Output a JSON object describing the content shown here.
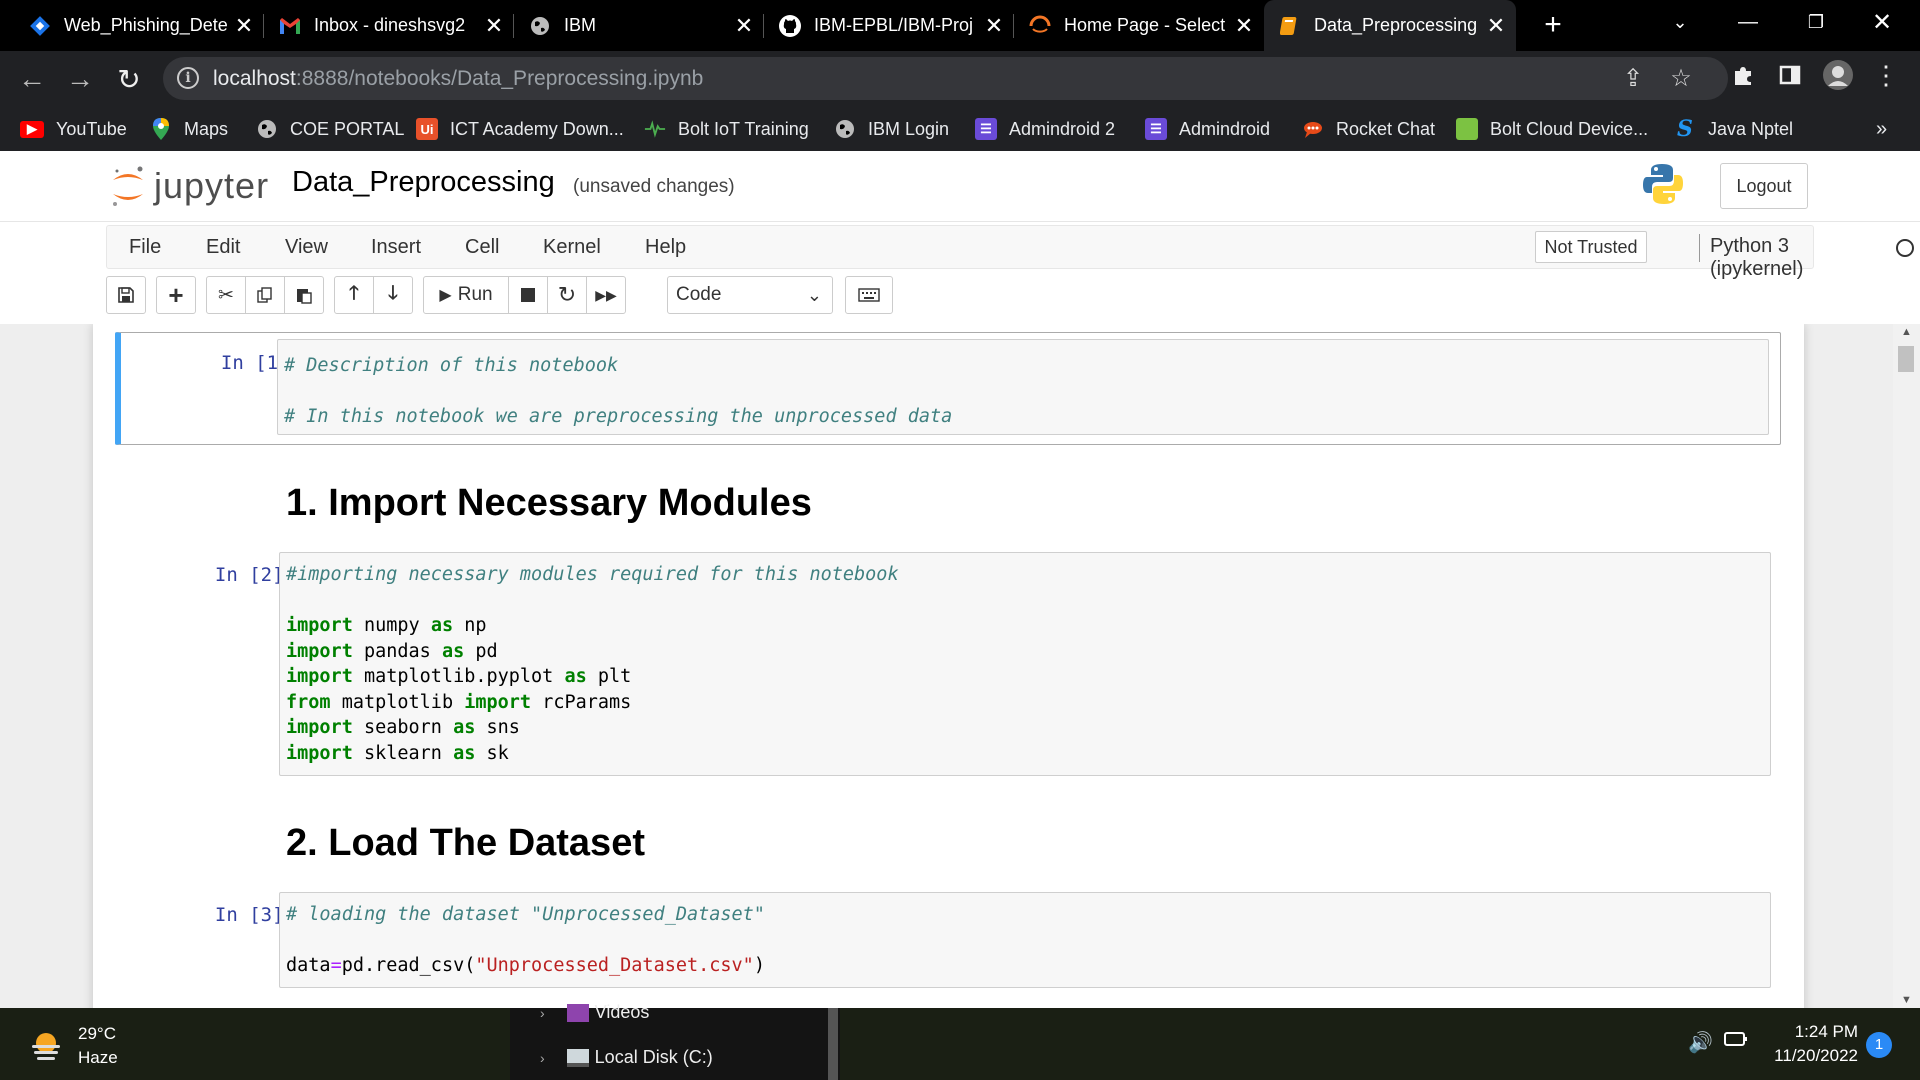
{
  "browser": {
    "tabs": [
      {
        "label": "Web_Phishing_Dete",
        "icon": "diamond-icon"
      },
      {
        "label": "Inbox - dineshsvg2",
        "icon": "gmail-icon"
      },
      {
        "label": "IBM",
        "icon": "globe-icon"
      },
      {
        "label": "IBM-EPBL/IBM-Proj",
        "icon": "github-icon"
      },
      {
        "label": "Home Page - Select",
        "icon": "spinner-icon"
      },
      {
        "label": "Data_Preprocessing",
        "icon": "notebook-icon"
      }
    ],
    "active_tab_index": 5,
    "close_glyph": "✕",
    "url_host": "localhost",
    "url_rest": ":8888/notebooks/Data_Preprocessing.ipynb",
    "bookmarks": [
      {
        "label": "YouTube",
        "icon": "youtube-icon",
        "color": "#ff0000"
      },
      {
        "label": "Maps",
        "icon": "maps-pin-icon",
        "color": "#34a853"
      },
      {
        "label": "COE PORTAL",
        "icon": "globe-icon",
        "color": "#9aa0a6"
      },
      {
        "label": "ICT Academy Down...",
        "icon": "ui-logo-icon",
        "color": "#e8512a"
      },
      {
        "label": "Bolt IoT Training",
        "icon": "pulse-icon",
        "color": "#4caf50"
      },
      {
        "label": "IBM Login",
        "icon": "globe-icon",
        "color": "#9aa0a6"
      },
      {
        "label": "Admindroid 2",
        "icon": "list-icon",
        "color": "#6a4bd8"
      },
      {
        "label": "Admindroid",
        "icon": "list-icon",
        "color": "#6a4bd8"
      },
      {
        "label": "Rocket Chat",
        "icon": "rocket-icon",
        "color": "#e64a19"
      },
      {
        "label": "Bolt Cloud Device...",
        "icon": "bolt-cloud-icon",
        "color": "#7cc242"
      },
      {
        "label": "Java Nptel",
        "icon": "s-logo-icon",
        "color": "#2196f3"
      }
    ],
    "bookmarks_overflow": "»"
  },
  "jupyter": {
    "logo_text": "jupyter",
    "notebook_title": "Data_Preprocessing",
    "save_status": "(unsaved changes)",
    "logout_label": "Logout",
    "menu": [
      "File",
      "Edit",
      "View",
      "Insert",
      "Cell",
      "Kernel",
      "Help"
    ],
    "trust_label": "Not Trusted",
    "kernel_name": "Python 3 (ipykernel)",
    "run_label": "Run",
    "cell_type": "Code"
  },
  "cells": [
    {
      "prompt": "In [1]:"
    },
    {
      "heading": "1. Import Necessary Modules"
    },
    {
      "prompt": "In [2]:"
    },
    {
      "heading": "2. Load The Dataset"
    },
    {
      "prompt": "In [3]:"
    }
  ],
  "code": {
    "c1_line1": "# Description of this notebook",
    "c1_line2": "# In this notebook we are preprocessing the unprocessed data",
    "c2_comment": "#importing necessary modules required for this notebook",
    "c3_comment": "# loading the dataset \"Unprocessed_Dataset\"",
    "c3_prefix": "data",
    "c3_eq": "=",
    "c3_call": "pd.read_csv(",
    "c3_string": "\"Unprocessed_Dataset.csv\"",
    "c3_close": ")",
    "kw_import": "import",
    "kw_as": "as",
    "kw_from": "from",
    "imports": [
      {
        "mod": "numpy",
        "alias": "np"
      },
      {
        "mod": "pandas",
        "alias": "pd"
      },
      {
        "mod": "matplotlib.pyplot",
        "alias": "plt"
      },
      {
        "from_mod": "matplotlib",
        "name": "rcParams"
      },
      {
        "mod": "seaborn",
        "alias": "sns"
      },
      {
        "mod": "sklearn",
        "alias": "sk"
      }
    ]
  },
  "taskbar": {
    "temperature": "29°C",
    "condition": "Haze",
    "explorer_items": [
      "Videos",
      "Local Disk (C:)"
    ],
    "time": "1:24 PM",
    "date": "11/20/2022",
    "notification_count": "1"
  }
}
